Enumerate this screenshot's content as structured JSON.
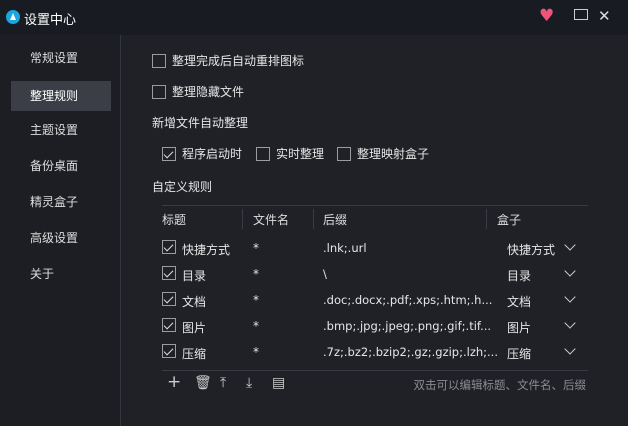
{
  "window": {
    "title": "设置中心",
    "icons": [
      "heart-icon",
      "feedback-icon",
      "close-icon"
    ]
  },
  "sidebar": {
    "items": [
      {
        "label": "常规设置"
      },
      {
        "label": "整理规则",
        "active": true
      },
      {
        "label": "主题设置"
      },
      {
        "label": "备份桌面"
      },
      {
        "label": "精灵盒子"
      },
      {
        "label": "高级设置"
      },
      {
        "label": "关于"
      }
    ]
  },
  "options": {
    "auto_arrange": {
      "label": "整理完成后自动重排图标",
      "checked": false
    },
    "hidden_files": {
      "label": "整理隐藏文件",
      "checked": false
    }
  },
  "new_files": {
    "heading": "新增文件自动整理",
    "items": [
      {
        "label": "程序启动时",
        "checked": true
      },
      {
        "label": "实时整理",
        "checked": false
      },
      {
        "label": "整理映射盒子",
        "checked": false
      }
    ]
  },
  "rules": {
    "heading": "自定义规则",
    "columns": [
      "标题",
      "文件名",
      "后缀",
      "盒子"
    ],
    "rows": [
      {
        "title": "快捷方式",
        "filename": "*",
        "suffix": ".lnk;.url",
        "box": "快捷方式",
        "checked": true
      },
      {
        "title": "目录",
        "filename": "*",
        "suffix": "\\",
        "box": "目录",
        "checked": true
      },
      {
        "title": "文档",
        "filename": "*",
        "suffix": ".doc;.docx;.pdf;.xps;.htm;.h...",
        "box": "文档",
        "checked": true
      },
      {
        "title": "图片",
        "filename": "*",
        "suffix": ".bmp;.jpg;.jpeg;.png;.gif;.tif...",
        "box": "图片",
        "checked": true
      },
      {
        "title": "压缩",
        "filename": "*",
        "suffix": ".7z;.bz2;.bzip2;.gz;.gzip;.lzh;...",
        "box": "压缩",
        "checked": true
      }
    ],
    "toolbar": {
      "add": "+",
      "hint": "双击可以编辑标题、文件名、后缀"
    }
  }
}
